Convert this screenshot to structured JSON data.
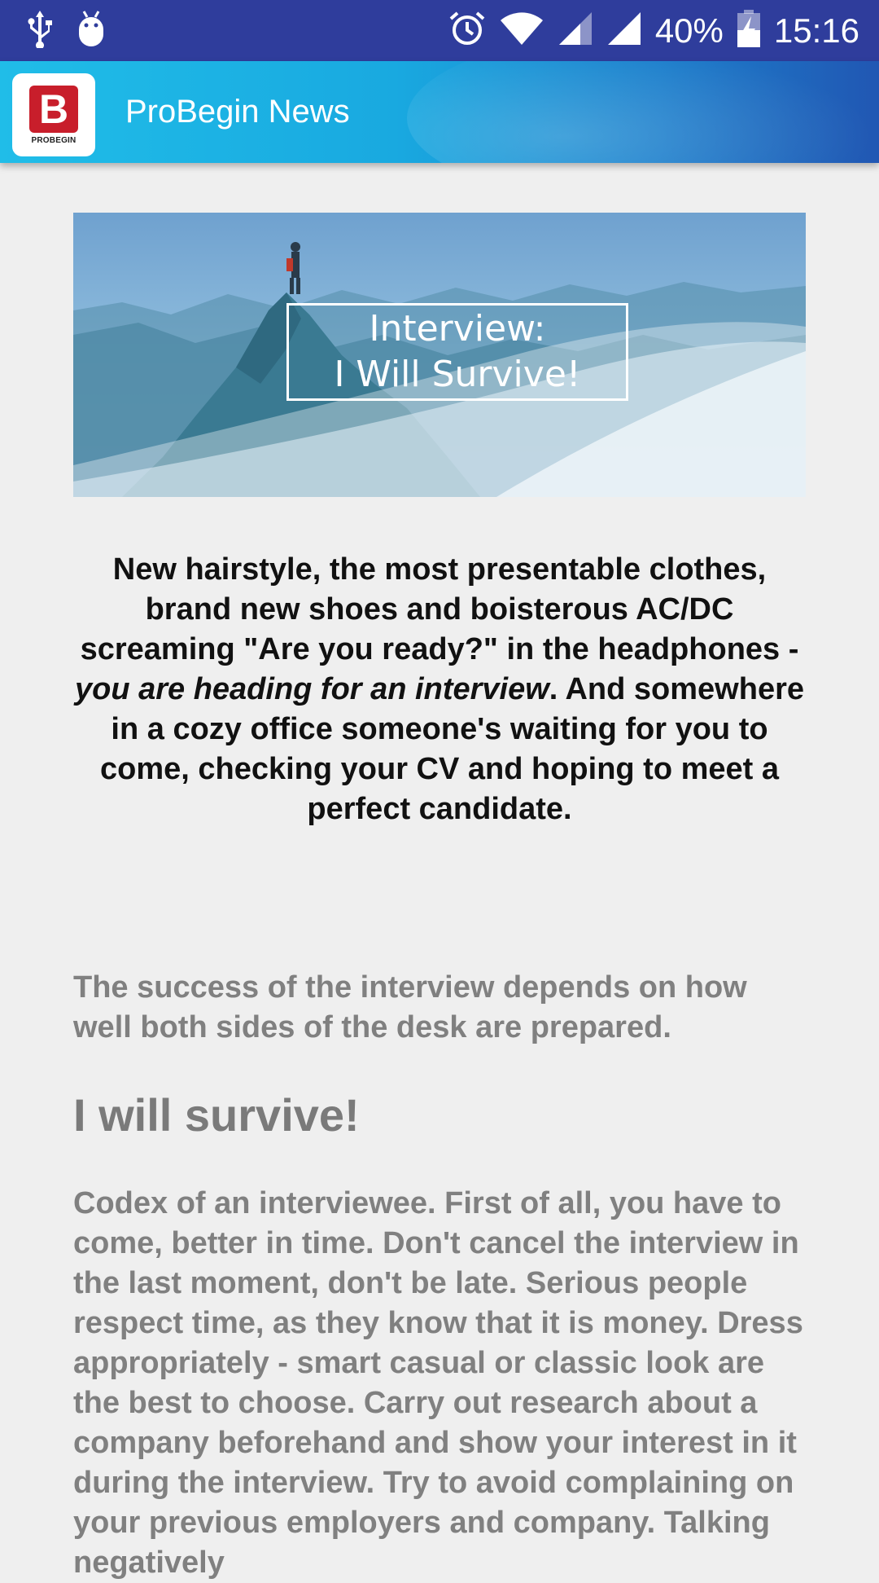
{
  "status_bar": {
    "battery": "40%",
    "time": "15:16",
    "icons_left": [
      "usb-icon",
      "android-debug-icon"
    ],
    "icons_right": [
      "alarm-icon",
      "wifi-icon",
      "signal-icon",
      "signal-full-icon",
      "battery-charging-icon"
    ]
  },
  "app_bar": {
    "title": "ProBegin News",
    "logo_letter": "B",
    "logo_text": "PROBEGIN"
  },
  "banner": {
    "line1": "Interview:",
    "line2": "I Will Survive!"
  },
  "article": {
    "lead_part1": "New hairstyle, the most presentable clothes, brand new shoes and boisterous AC/DC screaming \"Are you ready?\" in the headphones - ",
    "lead_italic": "you are heading for an interview",
    "lead_part2": ". And somewhere in a cozy office someone's waiting for you to come, checking your CV and hoping to meet a perfect candidate.",
    "subtitle": "The success of the interview depends on how well both sides of the desk are prepared.",
    "heading": "I will survive!",
    "body": "Codex of an interviewee. First of all, you have to come, better in time. Don't cancel the interview in the last moment, don't be late. Serious people respect time, as they know that it is money. Dress appropriately - smart casual or classic look are the best to choose. Carry out research about a company beforehand and show your interest in it during the interview. Try to avoid complaining on your previous employers and company. Talking negatively"
  },
  "colors": {
    "status_bar": "#2f3d9c",
    "app_bar_start": "#20bde8",
    "app_bar_end": "#2157b3",
    "background": "#efefef",
    "logo_red": "#c81e2b"
  }
}
